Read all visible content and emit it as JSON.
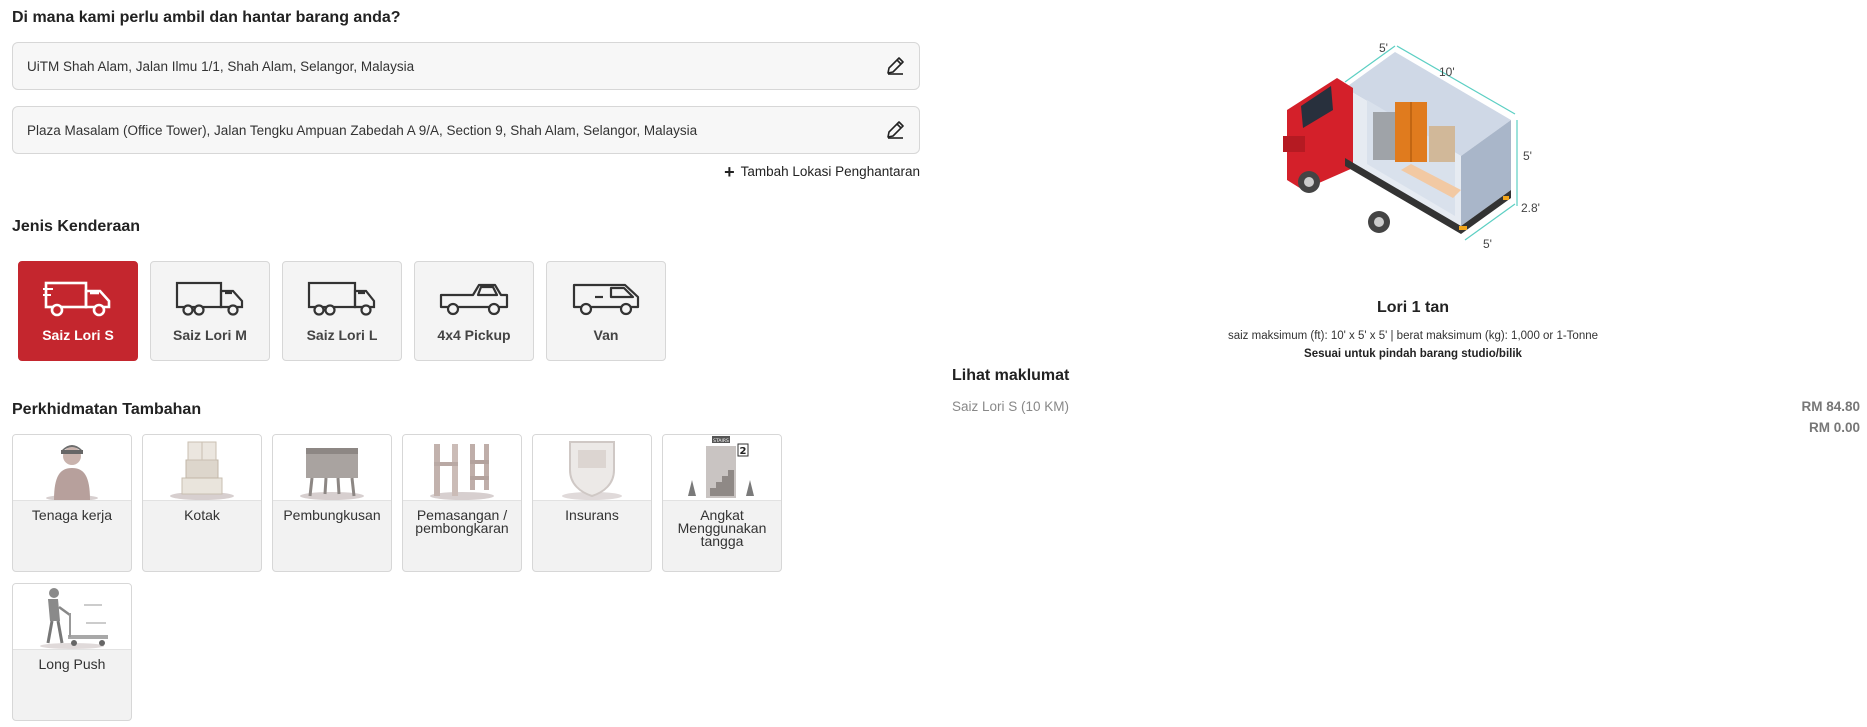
{
  "location": {
    "heading": "Di mana kami perlu ambil dan hantar barang anda?",
    "pickup": "UiTM Shah Alam, Jalan Ilmu 1/1, Shah Alam, Selangor, Malaysia",
    "dropoff": "Plaza Masalam (Office Tower), Jalan Tengku Ampuan Zabedah A 9/A, Section 9, Shah Alam, Selangor, Malaysia",
    "add_label": "Tambah Lokasi Penghantaran"
  },
  "vehicles": {
    "heading": "Jenis Kenderaan",
    "items": [
      {
        "label": "Saiz Lori S",
        "icon": "small-lorry-icon",
        "selected": true
      },
      {
        "label": "Saiz Lori M",
        "icon": "medium-lorry-icon",
        "selected": false
      },
      {
        "label": "Saiz Lori L",
        "icon": "large-lorry-icon",
        "selected": false
      },
      {
        "label": "4x4 Pickup",
        "icon": "pickup-icon",
        "selected": false
      },
      {
        "label": "Van",
        "icon": "van-icon",
        "selected": false
      }
    ]
  },
  "services": {
    "heading": "Perkhidmatan Tambahan",
    "items": [
      {
        "label": "Tenaga kerja",
        "icon": "worker-icon"
      },
      {
        "label": "Kotak",
        "icon": "boxes-icon"
      },
      {
        "label": "Pembungkusan",
        "icon": "packing-icon"
      },
      {
        "label": "Pemasangan / pembongkaran",
        "icon": "assembly-icon"
      },
      {
        "label": "Insurans",
        "icon": "insurance-icon"
      },
      {
        "label": "Angkat Menggunakan tangga",
        "icon": "stairs-icon",
        "stair_sign": "STAIRS",
        "floor": "2"
      },
      {
        "label": "Long Push",
        "icon": "trolley-icon"
      }
    ]
  },
  "truck": {
    "dims": {
      "top_width": "5'",
      "length": "10'",
      "height": "5'",
      "floor_height": "2.8'",
      "bottom_width": "5'"
    },
    "title": "Lori 1 tan",
    "spec": "saiz maksimum (ft): 10' x 5' x 5' | berat maksimum (kg): 1,000 or 1-Tonne",
    "suitable": "Sesuai untuk pindah barang studio/bilik"
  },
  "summary": {
    "heading": "Lihat maklumat",
    "line_label": "Saiz Lori S (10 KM)",
    "line_price": "RM 84.80",
    "line_price2": "RM 0.00"
  },
  "colors": {
    "accent": "#c4262e"
  }
}
